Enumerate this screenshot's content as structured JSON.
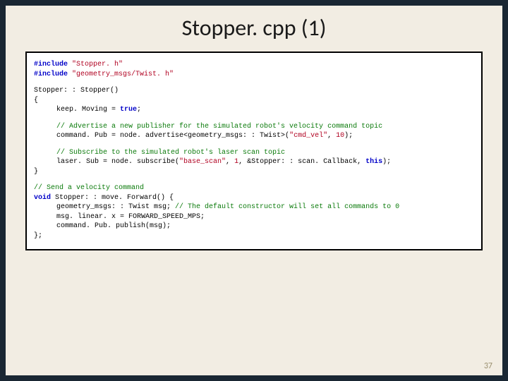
{
  "title": "Stopper. cpp (1)",
  "page_number": "37",
  "code": {
    "l1a": "#include",
    "l1b": " \"Stopper. h\"",
    "l2a": "#include",
    "l2b": " \"geometry_msgs/Twist. h\"",
    "l3": "Stopper: : Stopper()",
    "l4": "{",
    "l5a": "keep. Moving = ",
    "l5b": "true",
    "l5c": ";",
    "l6": "// Advertise a new publisher for the simulated robot's velocity command topic",
    "l7a": "command. Pub = node. advertise<geometry_msgs: : Twist>(",
    "l7b": "\"cmd_vel\"",
    "l7c": ", ",
    "l7d": "10",
    "l7e": ");",
    "l8": "// Subscribe to the simulated robot's laser scan topic",
    "l9a": "laser. Sub = node. subscribe(",
    "l9b": "\"base_scan\"",
    "l9c": ", ",
    "l9d": "1",
    "l9e": ", &Stopper: : scan. Callback, ",
    "l9f": "this",
    "l9g": ");",
    "l10": "}",
    "l11": "// Send a velocity command",
    "l12a": "void",
    "l12b": " Stopper: : move. Forward() {",
    "l13a": "geometry_msgs: : Twist msg; ",
    "l13b": "// The default constructor will set all commands to 0",
    "l14": "msg. linear. x = FORWARD_SPEED_MPS;",
    "l15": "command. Pub. publish(msg);",
    "l16": "};"
  }
}
